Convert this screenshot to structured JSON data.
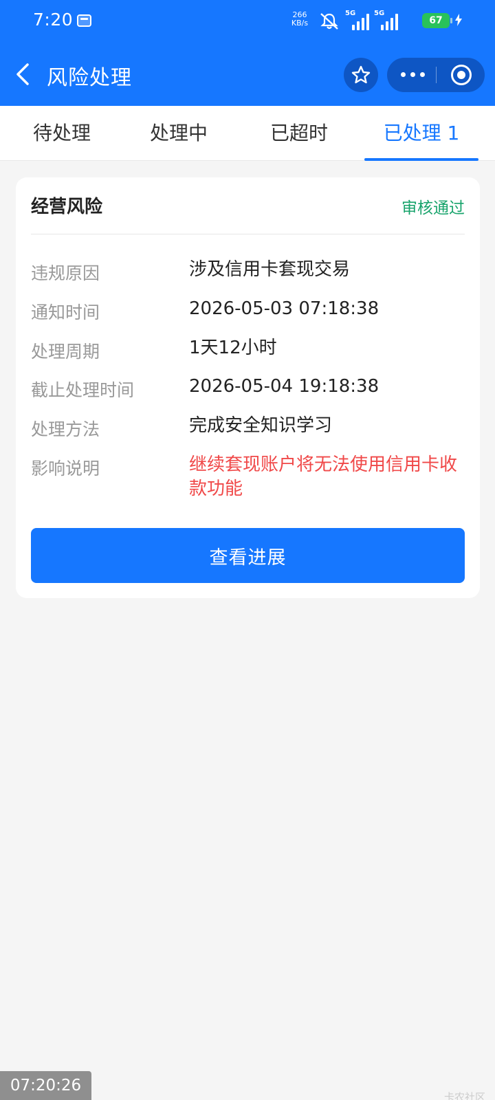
{
  "status_bar": {
    "time": "7:20",
    "net_speed_value": "266",
    "net_speed_unit": "KB/s",
    "signal_1_label": "5G",
    "signal_2_label": "5G",
    "battery": "67"
  },
  "nav": {
    "title": "风险处理"
  },
  "tabs": [
    {
      "label": "待处理"
    },
    {
      "label": "处理中"
    },
    {
      "label": "已超时"
    },
    {
      "label": "已处理 1",
      "active": true
    }
  ],
  "card": {
    "title": "经营风险",
    "status": "审核通过",
    "rows": [
      {
        "label": "违规原因",
        "value": "涉及信用卡套现交易"
      },
      {
        "label": "通知时间",
        "value": "2026-05-03 07:18:38"
      },
      {
        "label": "处理周期",
        "value": "1天12小时"
      },
      {
        "label": "截止处理时间",
        "value": "2026-05-04 19:18:38"
      },
      {
        "label": "处理方法",
        "value": "完成安全知识学习"
      },
      {
        "label": "影响说明",
        "value": "继续套现账户将无法使用信用卡收款功能"
      }
    ],
    "button_label": "查看进展"
  },
  "overlay": {
    "clock": "07:20:26",
    "watermark": "卡农社区"
  },
  "colors": {
    "brand": "#1677ff",
    "status_success": "#17a36b",
    "warning_text": "#f04848"
  }
}
